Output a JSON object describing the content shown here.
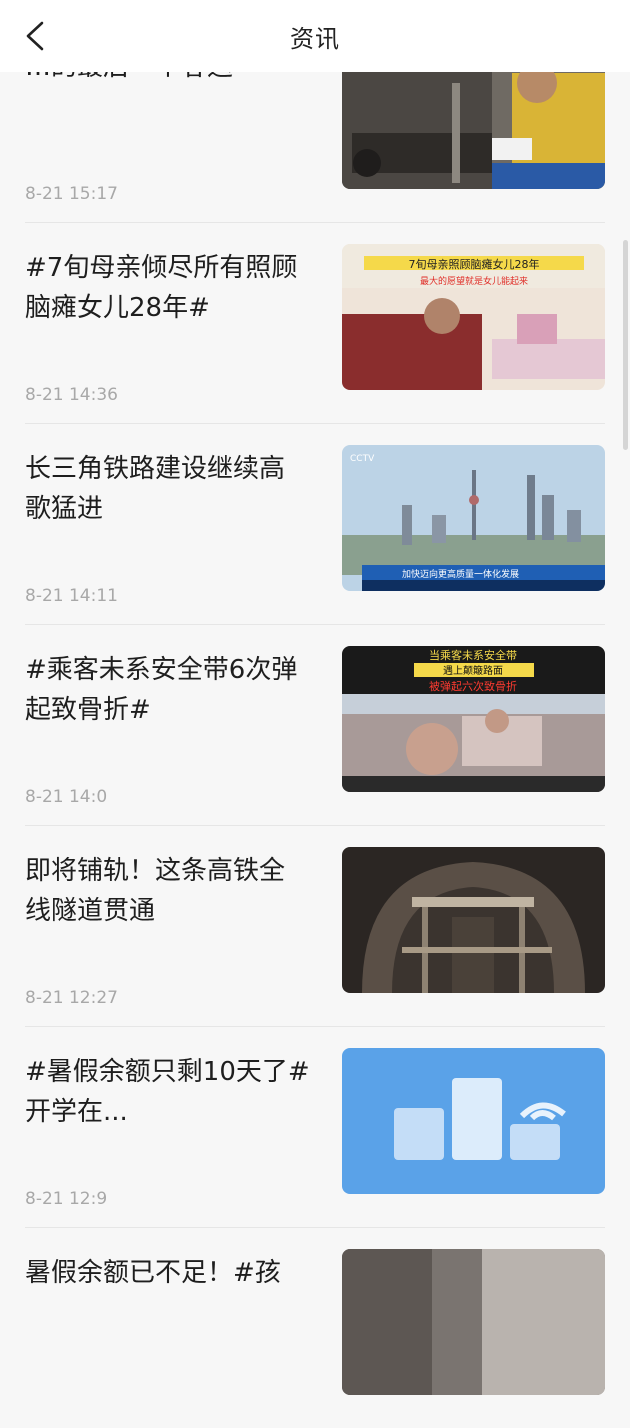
{
  "header": {
    "title": "资讯"
  },
  "news": [
    {
      "title": "…的最后一个春运",
      "time": "8-21 15:17",
      "image": "worker-repair-photo"
    },
    {
      "title": "#7旬母亲倾尽所有照顾\n脑瘫女儿28年#",
      "time": "8-21 14:36",
      "image": "mother-care-photo",
      "overlay": [
        "7旬母亲照顾脑瘫女儿28年",
        "最大的愿望就是女儿能起来"
      ]
    },
    {
      "title": "长三角铁路建设继续高\n歌猛进",
      "time": "8-21 14:11",
      "image": "shanghai-skyline-photo",
      "overlay": [
        "CCTV",
        "加快迈向更高质量一体化发展"
      ]
    },
    {
      "title": "#乘客未系安全带6次弹\n起致骨折#",
      "time": "8-21 14:0",
      "image": "bus-passenger-photo",
      "overlay": [
        "当乘客未系安全带",
        "遇上颠簸路面",
        "被弹起六次致骨折"
      ]
    },
    {
      "title": "即将铺轨！这条高铁全\n线隧道贯通",
      "time": "8-21 12:27",
      "image": "tunnel-photo"
    },
    {
      "title": "#暑假余额只剩10天了#\n开学在...",
      "time": "8-21 12:9",
      "image": "placeholder-chart-icon"
    },
    {
      "title": "暑假余额已不足！#孩",
      "time": "",
      "image": "partial-photo"
    }
  ]
}
